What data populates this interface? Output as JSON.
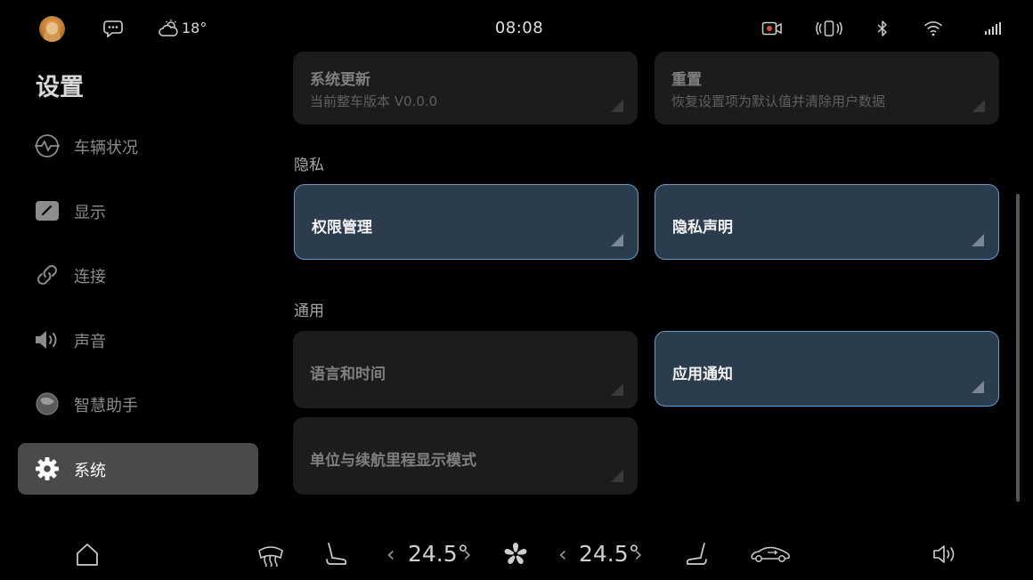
{
  "status_bar": {
    "weather_temp": "18°",
    "clock": "08:08"
  },
  "sidebar": {
    "title": "设置",
    "items": [
      {
        "label": "车辆状况",
        "icon": "vehicle-status-icon"
      },
      {
        "label": "显示",
        "icon": "display-icon"
      },
      {
        "label": "连接",
        "icon": "link-icon"
      },
      {
        "label": "声音",
        "icon": "speaker-icon"
      },
      {
        "label": "智慧助手",
        "icon": "assistant-icon"
      },
      {
        "label": "系统",
        "icon": "gear-icon",
        "active": true
      }
    ]
  },
  "main": {
    "top_cards": [
      {
        "title": "系统更新",
        "subtitle": "当前整车版本 V0.0.0"
      },
      {
        "title": "重置",
        "subtitle": "恢复设置项为默认值并清除用户数据"
      }
    ],
    "privacy": {
      "title": "隐私",
      "cards": [
        {
          "title": "权限管理",
          "highlighted": true
        },
        {
          "title": "隐私声明",
          "highlighted": true
        }
      ]
    },
    "general": {
      "title": "通用",
      "cards": [
        {
          "title": "语言和时间",
          "highlighted": false
        },
        {
          "title": "应用通知",
          "highlighted": true
        },
        {
          "title": "单位与续航里程显示模式",
          "highlighted": false
        }
      ]
    }
  },
  "dock": {
    "left_temp": "24.5°",
    "right_temp": "24.5°",
    "chevron_left": "‹",
    "chevron_right": "›"
  },
  "colors": {
    "background": "#000000",
    "card": "#1c1c1d",
    "card_highlight": "#2b3d4c",
    "highlight_border": "#5e9ed0",
    "nav_active": "#4a4a4c",
    "record_dot": "#e04545"
  }
}
